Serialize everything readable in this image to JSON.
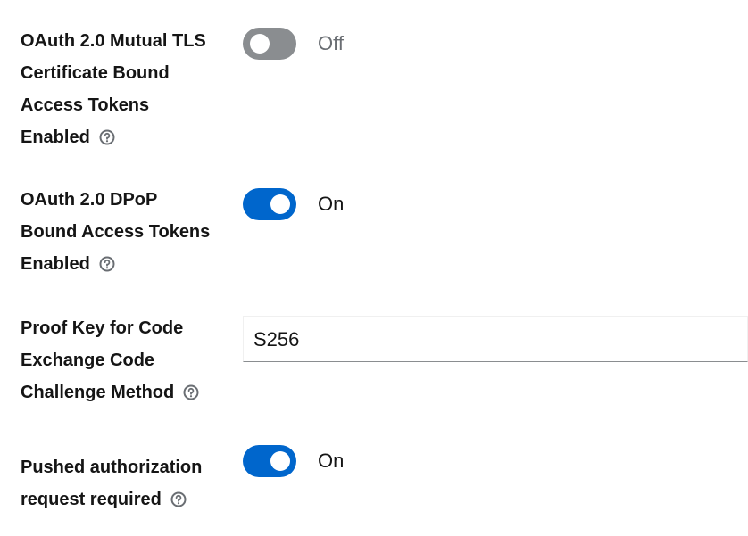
{
  "fields": [
    {
      "label_lines": [
        "OAuth 2.0 Mutual TLS",
        "Certificate Bound",
        "Access Tokens",
        "Enabled"
      ],
      "state": "Off",
      "help_icon": "help-circle-icon"
    },
    {
      "label_lines": [
        "OAuth 2.0 DPoP",
        "Bound Access Tokens",
        "Enabled"
      ],
      "state": "On",
      "help_icon": "help-circle-icon"
    },
    {
      "label_lines": [
        "Proof Key for Code",
        "Exchange Code",
        "Challenge Method"
      ],
      "value": "S256",
      "help_icon": "help-circle-icon"
    },
    {
      "label_lines": [
        "Pushed authorization",
        "request required"
      ],
      "state": "On",
      "help_icon": "help-circle-icon"
    }
  ],
  "colors": {
    "switch_on": "#0066cc",
    "switch_off": "#8a8d90",
    "text": "#151515",
    "muted_text": "#6a6e73"
  }
}
